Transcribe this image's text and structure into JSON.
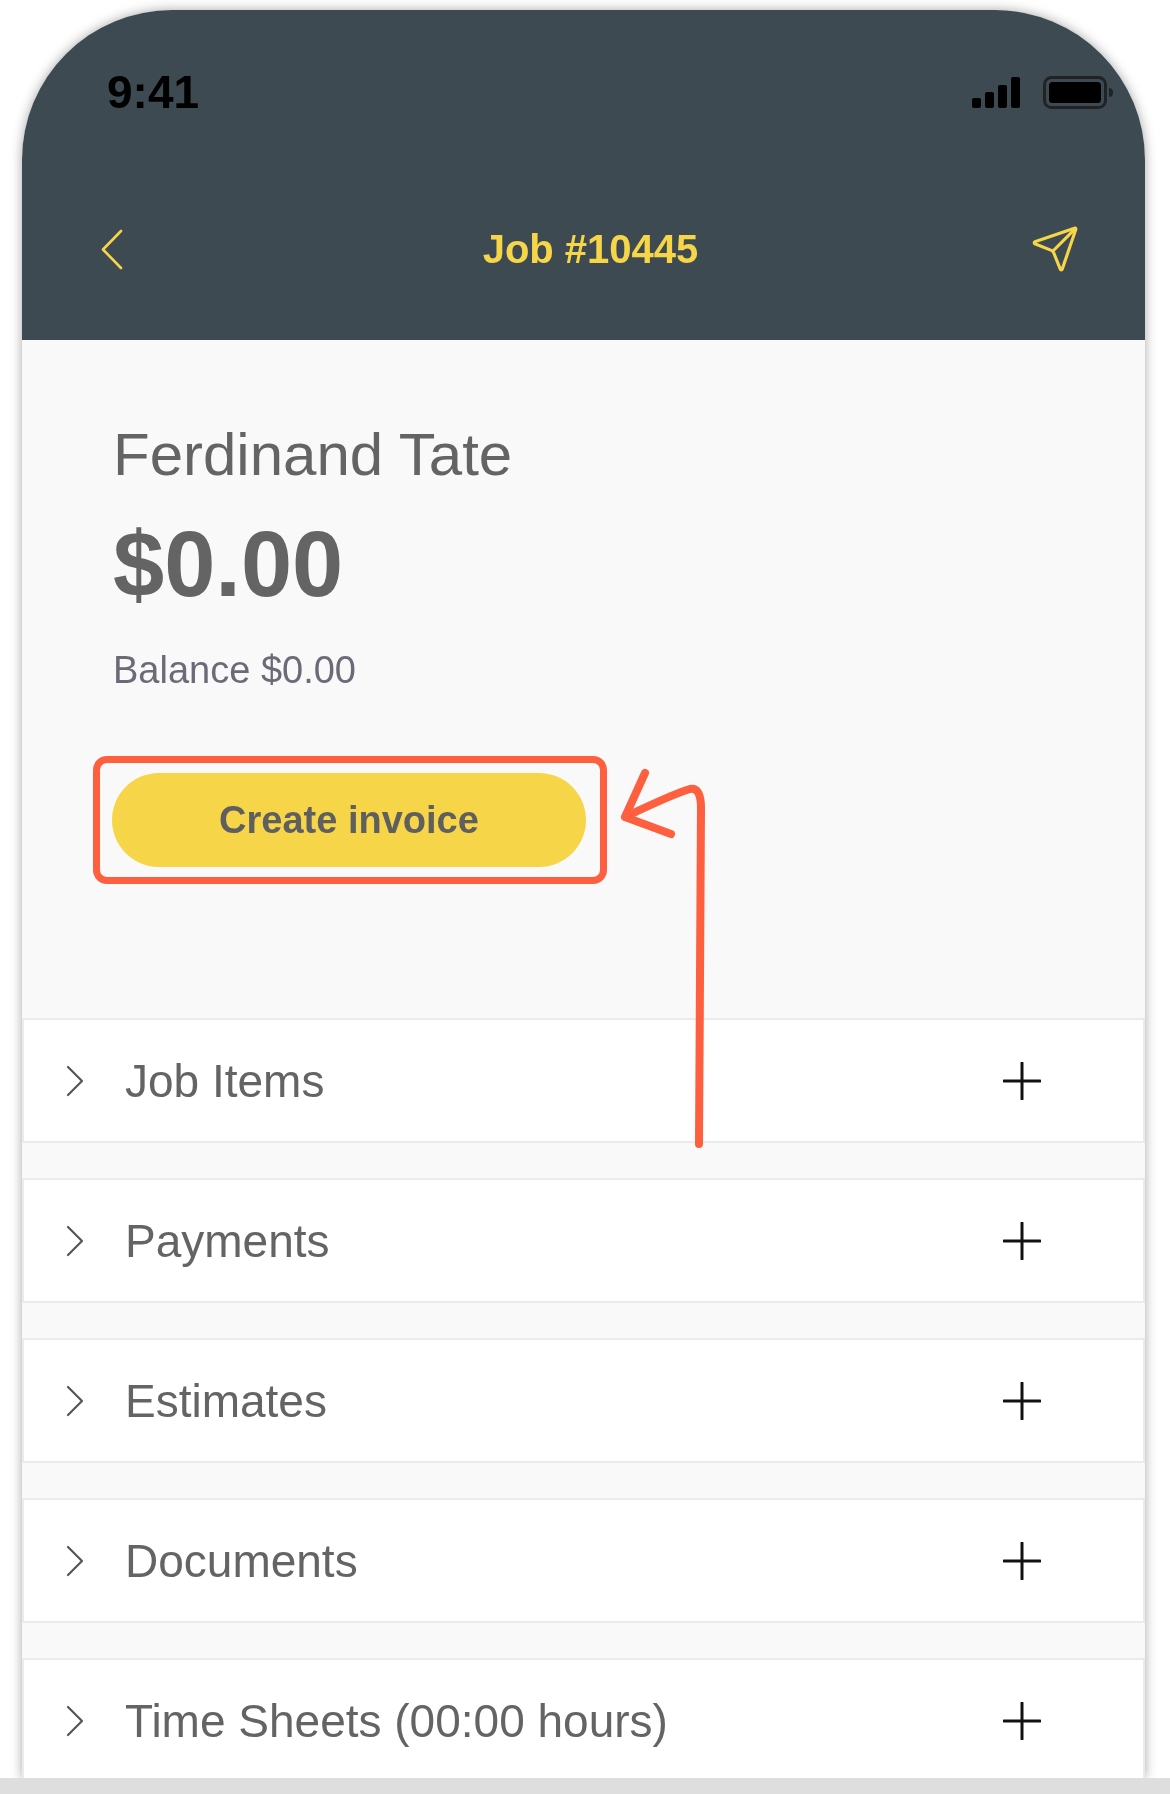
{
  "status_bar": {
    "time": "9:41"
  },
  "nav_bar": {
    "title": "Job #10445"
  },
  "job": {
    "customer": "Ferdinand Tate",
    "total": "$0.00",
    "balance": "Balance $0.00"
  },
  "create_invoice_button": {
    "label": "Create invoice",
    "highlighted": true
  },
  "sections": [
    {
      "label": "Job Items",
      "expanded": false
    },
    {
      "label": "Payments",
      "expanded": false
    },
    {
      "label": "Estimates",
      "expanded": false
    },
    {
      "label": "Documents",
      "expanded": false
    },
    {
      "label": "Time Sheets (00:00 hours)",
      "expanded": false
    }
  ]
}
